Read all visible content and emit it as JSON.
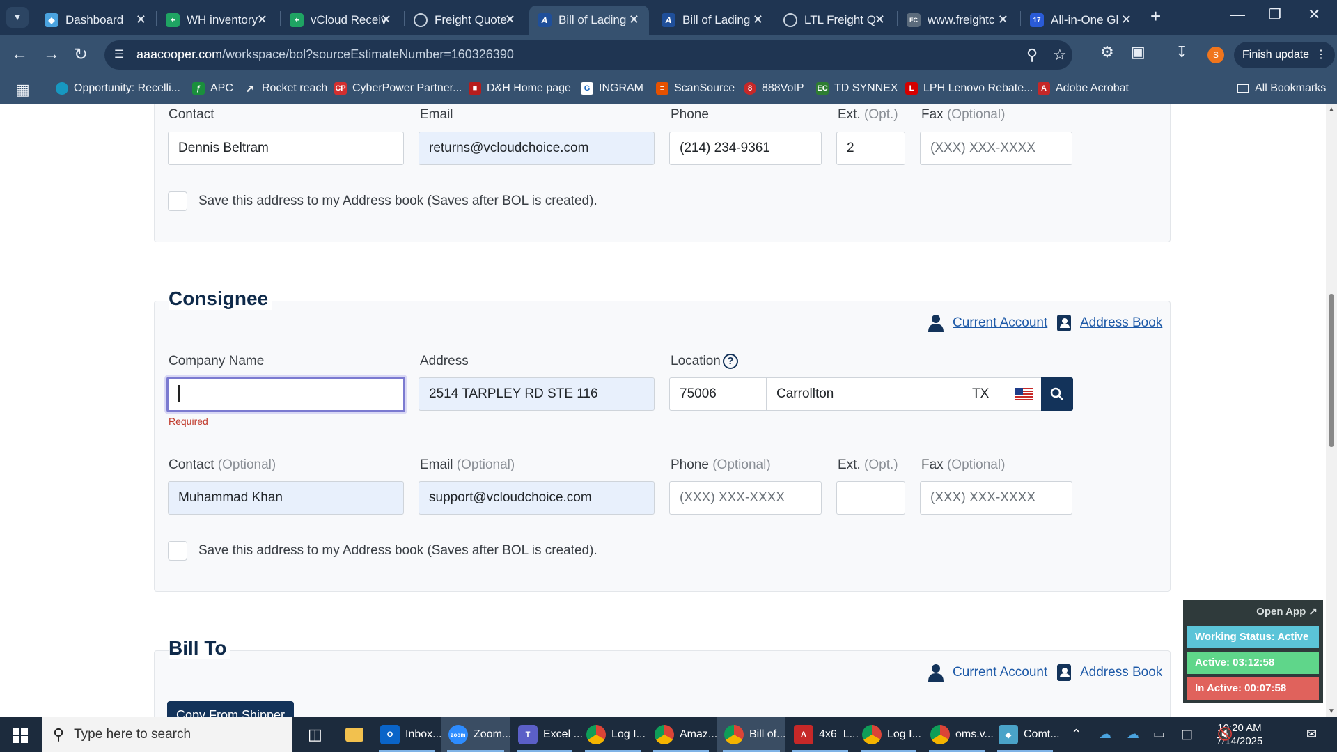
{
  "browser": {
    "tabs": [
      {
        "title": "Dashboard",
        "icon": "dashboard-icon",
        "color": "#4aa3df"
      },
      {
        "title": "WH inventory",
        "icon": "sheets-icon",
        "color": "#1fa463"
      },
      {
        "title": "vCloud Receiv",
        "icon": "sheets-icon",
        "color": "#1fa463"
      },
      {
        "title": "Freight Quote",
        "icon": "globe-icon",
        "color": "#8a96a3"
      },
      {
        "title": "Bill of Lading",
        "icon": "aaa-icon",
        "color": "#1f4f9a"
      },
      {
        "title": "Bill of Lading",
        "icon": "aaa-icon",
        "color": "#1f4f9a"
      },
      {
        "title": "LTL Freight Q",
        "icon": "globe-icon",
        "color": "#8a96a3"
      },
      {
        "title": "www.freightc",
        "icon": "fcc-icon",
        "color": "#5b6b7c"
      },
      {
        "title": "All-in-One Gl",
        "icon": "t7-icon",
        "color": "#2a5bd7"
      }
    ],
    "url_host": "aaacooper.com",
    "url_path": "/workspace/bol?sourceEstimateNumber=160326390",
    "profile_initial": "S",
    "finish_update": "Finish update",
    "bookmarks": [
      {
        "label": "Opportunity: Recelli...",
        "icon": "salesforce-icon",
        "color": "#1798c1"
      },
      {
        "label": "APC",
        "icon": "apc-icon",
        "color": "#1a8f3c"
      },
      {
        "label": "Rocket reach",
        "icon": "rocket-icon",
        "color": "#c0392b"
      },
      {
        "label": "CyberPower Partner...",
        "icon": "cp-icon",
        "color": "#d32f2f"
      },
      {
        "label": "D&H Home page",
        "icon": "dh-icon",
        "color": "#b71c1c"
      },
      {
        "label": "INGRAM",
        "icon": "ingram-icon",
        "color": "#1565c0"
      },
      {
        "label": "ScanSource",
        "icon": "scansource-icon",
        "color": "#e65100"
      },
      {
        "label": "888VoIP",
        "icon": "voip-icon",
        "color": "#c62828"
      },
      {
        "label": "TD SYNNEX",
        "icon": "ec-icon",
        "color": "#2e7d32"
      },
      {
        "label": "LPH Lenovo Rebate...",
        "icon": "lenovo-icon",
        "color": "#d50000"
      },
      {
        "label": "Adobe Acrobat",
        "icon": "acrobat-icon",
        "color": "#c62828"
      }
    ],
    "all_bookmarks": "All Bookmarks"
  },
  "shipper_contact": {
    "contact_label": "Contact",
    "contact_value": "Dennis Beltram",
    "email_label": "Email",
    "email_value": "returns@vcloudchoice.com",
    "phone_label": "Phone",
    "phone_value": "(214) 234-9361",
    "ext_label": "Ext.",
    "ext_opt": "(Opt.)",
    "ext_value": "2",
    "fax_label": "Fax",
    "fax_opt": "(Optional)",
    "fax_placeholder": "(XXX) XXX-XXXX",
    "save_label": "Save this address to my Address book (Saves after BOL is created)."
  },
  "consignee": {
    "title": "Consignee",
    "current_account": "Current Account",
    "address_book": "Address Book",
    "company_label": "Company Name",
    "company_value": "",
    "company_error": "Required",
    "address_label": "Address",
    "address_value": "2514 TARPLEY RD STE 116",
    "location_label": "Location",
    "zip_value": "75006",
    "city_value": "Carrollton",
    "state_value": "TX",
    "contact_label": "Contact",
    "contact_opt": "(Optional)",
    "contact_value": "Muhammad Khan",
    "email_label": "Email",
    "email_opt": "(Optional)",
    "email_value": "support@vcloudchoice.com",
    "phone_label": "Phone",
    "phone_opt": "(Optional)",
    "phone_placeholder": "(XXX) XXX-XXXX",
    "ext_label": "Ext.",
    "ext_opt": "(Opt.)",
    "ext_value": "",
    "fax_label": "Fax",
    "fax_opt": "(Optional)",
    "fax_placeholder": "(XXX) XXX-XXXX",
    "save_label": "Save this address to my Address book (Saves after BOL is created)."
  },
  "bill_to": {
    "title": "Bill To",
    "current_account": "Current Account",
    "address_book": "Address Book",
    "copy_button": "Copy From Shipper"
  },
  "widget": {
    "open_app": "Open App ↗",
    "working_status": "Working Status: Active",
    "active_time": "Active: 03:12:58",
    "inactive_time": "In Active: 00:07:58",
    "colors": {
      "status": "#5bc4d8",
      "active": "#5fd68a",
      "inactive": "#e0625c"
    }
  },
  "taskbar": {
    "search_placeholder": "Type here to search",
    "apps": [
      {
        "label": "Inbox...",
        "icon": "outlook-icon",
        "color": "#0a64c8"
      },
      {
        "label": "Zoom...",
        "icon": "zoom-icon",
        "color": "#2d8cff"
      },
      {
        "label": "Excel ...",
        "icon": "teams-icon",
        "color": "#5b5fc7"
      },
      {
        "label": "Log I...",
        "icon": "chrome-icon",
        "color": "#db4437"
      },
      {
        "label": "Amaz...",
        "icon": "chrome-icon",
        "color": "#db4437"
      },
      {
        "label": "Bill of...",
        "icon": "chrome-icon",
        "color": "#db4437"
      },
      {
        "label": "4x6_L...",
        "icon": "acrobat-icon",
        "color": "#c62828"
      },
      {
        "label": "Log I...",
        "icon": "chrome-icon",
        "color": "#db4437"
      },
      {
        "label": "oms.v...",
        "icon": "chrome-icon",
        "color": "#db4437"
      },
      {
        "label": "Comt...",
        "icon": "app-icon",
        "color": "#4aa3c8"
      }
    ],
    "time": "10:20 AM",
    "date": "7/14/2025"
  }
}
